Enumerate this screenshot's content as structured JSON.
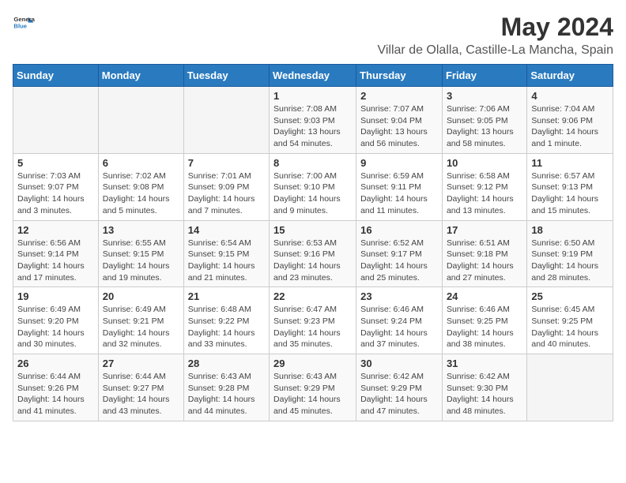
{
  "logo": {
    "general": "General",
    "blue": "Blue"
  },
  "title": "May 2024",
  "subtitle": "Villar de Olalla, Castille-La Mancha, Spain",
  "days_of_week": [
    "Sunday",
    "Monday",
    "Tuesday",
    "Wednesday",
    "Thursday",
    "Friday",
    "Saturday"
  ],
  "weeks": [
    [
      {
        "day": "",
        "info": ""
      },
      {
        "day": "",
        "info": ""
      },
      {
        "day": "",
        "info": ""
      },
      {
        "day": "1",
        "info": "Sunrise: 7:08 AM\nSunset: 9:03 PM\nDaylight: 13 hours and 54 minutes."
      },
      {
        "day": "2",
        "info": "Sunrise: 7:07 AM\nSunset: 9:04 PM\nDaylight: 13 hours and 56 minutes."
      },
      {
        "day": "3",
        "info": "Sunrise: 7:06 AM\nSunset: 9:05 PM\nDaylight: 13 hours and 58 minutes."
      },
      {
        "day": "4",
        "info": "Sunrise: 7:04 AM\nSunset: 9:06 PM\nDaylight: 14 hours and 1 minute."
      }
    ],
    [
      {
        "day": "5",
        "info": "Sunrise: 7:03 AM\nSunset: 9:07 PM\nDaylight: 14 hours and 3 minutes."
      },
      {
        "day": "6",
        "info": "Sunrise: 7:02 AM\nSunset: 9:08 PM\nDaylight: 14 hours and 5 minutes."
      },
      {
        "day": "7",
        "info": "Sunrise: 7:01 AM\nSunset: 9:09 PM\nDaylight: 14 hours and 7 minutes."
      },
      {
        "day": "8",
        "info": "Sunrise: 7:00 AM\nSunset: 9:10 PM\nDaylight: 14 hours and 9 minutes."
      },
      {
        "day": "9",
        "info": "Sunrise: 6:59 AM\nSunset: 9:11 PM\nDaylight: 14 hours and 11 minutes."
      },
      {
        "day": "10",
        "info": "Sunrise: 6:58 AM\nSunset: 9:12 PM\nDaylight: 14 hours and 13 minutes."
      },
      {
        "day": "11",
        "info": "Sunrise: 6:57 AM\nSunset: 9:13 PM\nDaylight: 14 hours and 15 minutes."
      }
    ],
    [
      {
        "day": "12",
        "info": "Sunrise: 6:56 AM\nSunset: 9:14 PM\nDaylight: 14 hours and 17 minutes."
      },
      {
        "day": "13",
        "info": "Sunrise: 6:55 AM\nSunset: 9:15 PM\nDaylight: 14 hours and 19 minutes."
      },
      {
        "day": "14",
        "info": "Sunrise: 6:54 AM\nSunset: 9:15 PM\nDaylight: 14 hours and 21 minutes."
      },
      {
        "day": "15",
        "info": "Sunrise: 6:53 AM\nSunset: 9:16 PM\nDaylight: 14 hours and 23 minutes."
      },
      {
        "day": "16",
        "info": "Sunrise: 6:52 AM\nSunset: 9:17 PM\nDaylight: 14 hours and 25 minutes."
      },
      {
        "day": "17",
        "info": "Sunrise: 6:51 AM\nSunset: 9:18 PM\nDaylight: 14 hours and 27 minutes."
      },
      {
        "day": "18",
        "info": "Sunrise: 6:50 AM\nSunset: 9:19 PM\nDaylight: 14 hours and 28 minutes."
      }
    ],
    [
      {
        "day": "19",
        "info": "Sunrise: 6:49 AM\nSunset: 9:20 PM\nDaylight: 14 hours and 30 minutes."
      },
      {
        "day": "20",
        "info": "Sunrise: 6:49 AM\nSunset: 9:21 PM\nDaylight: 14 hours and 32 minutes."
      },
      {
        "day": "21",
        "info": "Sunrise: 6:48 AM\nSunset: 9:22 PM\nDaylight: 14 hours and 33 minutes."
      },
      {
        "day": "22",
        "info": "Sunrise: 6:47 AM\nSunset: 9:23 PM\nDaylight: 14 hours and 35 minutes."
      },
      {
        "day": "23",
        "info": "Sunrise: 6:46 AM\nSunset: 9:24 PM\nDaylight: 14 hours and 37 minutes."
      },
      {
        "day": "24",
        "info": "Sunrise: 6:46 AM\nSunset: 9:25 PM\nDaylight: 14 hours and 38 minutes."
      },
      {
        "day": "25",
        "info": "Sunrise: 6:45 AM\nSunset: 9:25 PM\nDaylight: 14 hours and 40 minutes."
      }
    ],
    [
      {
        "day": "26",
        "info": "Sunrise: 6:44 AM\nSunset: 9:26 PM\nDaylight: 14 hours and 41 minutes."
      },
      {
        "day": "27",
        "info": "Sunrise: 6:44 AM\nSunset: 9:27 PM\nDaylight: 14 hours and 43 minutes."
      },
      {
        "day": "28",
        "info": "Sunrise: 6:43 AM\nSunset: 9:28 PM\nDaylight: 14 hours and 44 minutes."
      },
      {
        "day": "29",
        "info": "Sunrise: 6:43 AM\nSunset: 9:29 PM\nDaylight: 14 hours and 45 minutes."
      },
      {
        "day": "30",
        "info": "Sunrise: 6:42 AM\nSunset: 9:29 PM\nDaylight: 14 hours and 47 minutes."
      },
      {
        "day": "31",
        "info": "Sunrise: 6:42 AM\nSunset: 9:30 PM\nDaylight: 14 hours and 48 minutes."
      },
      {
        "day": "",
        "info": ""
      }
    ]
  ]
}
